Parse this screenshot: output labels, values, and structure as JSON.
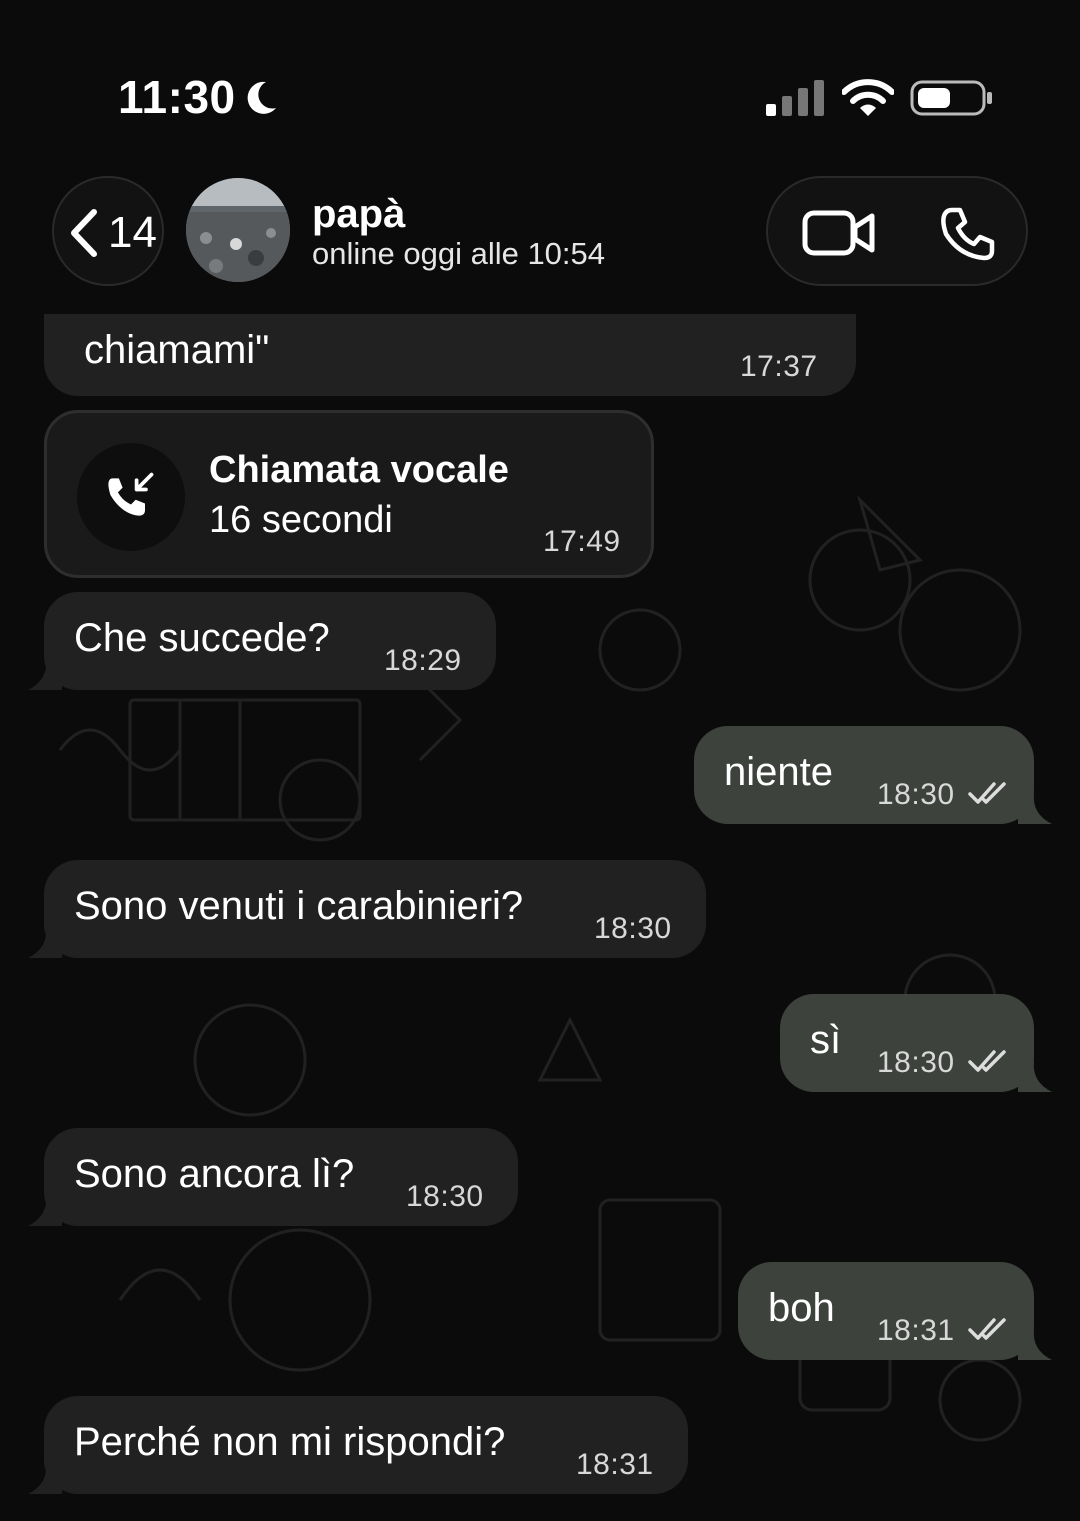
{
  "status_bar": {
    "time": "11:30",
    "focus_icon": "moon-icon",
    "signal_icon": "cellular-signal-icon",
    "wifi_icon": "wifi-icon",
    "battery_icon": "battery-icon"
  },
  "header": {
    "back_count": "14",
    "contact_name": "papà",
    "contact_status": "online oggi alle 10:54",
    "video_icon": "video-camera-icon",
    "call_icon": "phone-icon"
  },
  "colors": {
    "background": "#0b0b0b",
    "incoming_bubble": "#212121",
    "outgoing_bubble": "#3d423d",
    "time_text": "#d8d8d8"
  },
  "messages": [
    {
      "direction": "in",
      "text": "chiamami\"",
      "time": "17:37"
    },
    {
      "direction": "in",
      "type": "call",
      "title": "Chiamata vocale",
      "duration": "16 secondi",
      "time": "17:49",
      "icon": "incoming-call-icon"
    },
    {
      "direction": "in",
      "text": "Che succede?",
      "time": "18:29"
    },
    {
      "direction": "out",
      "text": "niente",
      "time": "18:30",
      "status": "read"
    },
    {
      "direction": "in",
      "text": "Sono venuti i carabinieri?",
      "time": "18:30"
    },
    {
      "direction": "out",
      "text": "sì",
      "time": "18:30",
      "status": "read"
    },
    {
      "direction": "in",
      "text": "Sono ancora lì?",
      "time": "18:30"
    },
    {
      "direction": "out",
      "text": "boh",
      "time": "18:31",
      "status": "read"
    },
    {
      "direction": "in",
      "text": "Perché non mi rispondi?",
      "time": "18:31"
    }
  ]
}
